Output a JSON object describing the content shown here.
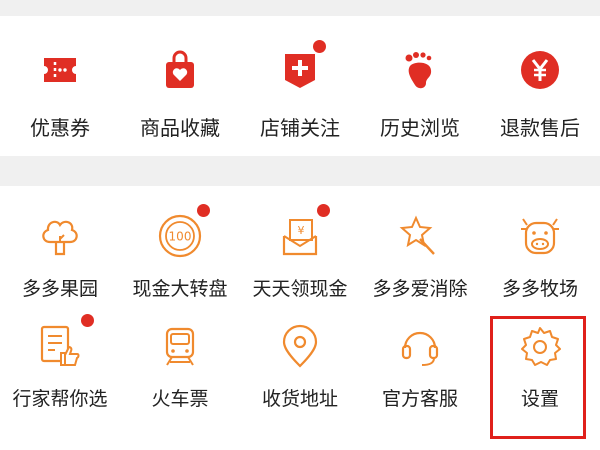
{
  "orders_section": {
    "items": [
      {
        "label": "优惠券",
        "icon": "coupon-ticket-icon",
        "badge": false
      },
      {
        "label": "商品收藏",
        "icon": "shopping-bag-heart-icon",
        "badge": false
      },
      {
        "label": "店铺关注",
        "icon": "store-plus-icon",
        "badge": true
      },
      {
        "label": "历史浏览",
        "icon": "footprint-icon",
        "badge": false
      },
      {
        "label": "退款售后",
        "icon": "yen-coin-icon",
        "badge": false
      }
    ]
  },
  "services_section": {
    "items": [
      {
        "label": "多多果园",
        "icon": "tree-icon",
        "badge": false
      },
      {
        "label": "现金大转盘",
        "icon": "wheel-100-icon",
        "badge": true
      },
      {
        "label": "天天领现金",
        "icon": "cash-envelope-icon",
        "badge": true
      },
      {
        "label": "多多爱消除",
        "icon": "star-wand-icon",
        "badge": false
      },
      {
        "label": "多多牧场",
        "icon": "cow-icon",
        "badge": false
      },
      {
        "label": "行家帮你选",
        "icon": "document-thumbs-up-icon",
        "badge": true
      },
      {
        "label": "火车票",
        "icon": "train-icon",
        "badge": false
      },
      {
        "label": "收货地址",
        "icon": "location-pin-icon",
        "badge": false
      },
      {
        "label": "官方客服",
        "icon": "headset-icon",
        "badge": false
      },
      {
        "label": "设置",
        "icon": "gear-icon",
        "badge": false
      }
    ]
  },
  "colors": {
    "primary_red": "#e02e24",
    "icon_orange": "#f08a2e",
    "badge_red": "#e02e24",
    "highlight_red": "#e0201b"
  }
}
